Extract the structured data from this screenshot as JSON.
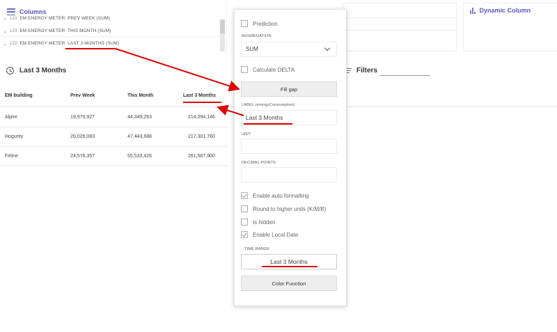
{
  "columns_panel": {
    "title": "Columns",
    "items": [
      {
        "type": "123",
        "label": "EM ENERGY METER: PREV WEEK (SUM)"
      },
      {
        "type": "123",
        "label": "EM ENERGY METER: THIS MONTH (SUM)"
      },
      {
        "type": "123",
        "label": "EM ENERGY METER: LAST 3 MONTHS (SUM)"
      }
    ]
  },
  "dynamic_column": {
    "title": "Dynamic Column"
  },
  "widget": {
    "title": "Last 3 Months"
  },
  "filters": {
    "label": "Filters"
  },
  "table": {
    "headers": [
      "EM building",
      "Prev Week",
      "This Month",
      "Last 3 Months"
    ],
    "rows": [
      [
        "Alpire",
        "19,979,927",
        "44,349,263",
        "214,094,146"
      ],
      [
        "Hogurity",
        "20,026,083",
        "47,443,688",
        "217,301,760"
      ],
      [
        "Feline",
        "24,576,357",
        "55,533,426",
        "261,587,900"
      ]
    ]
  },
  "popup": {
    "prediction_label": "Prediction",
    "aggregation_label": "AGGREGATION",
    "aggregation_value": "SUM",
    "calculate_delta_label": "Calculate DELTA",
    "fill_gap_label": "Fill gap",
    "label_field_label": "LABEL (energyConsumption)",
    "label_value": "Last 3 Months",
    "unit_label": "UNIT",
    "unit_value": "",
    "decimal_points_label": "DECIMAL POINTS",
    "decimal_points_value": "",
    "options": [
      {
        "label": "Enable auto formatting",
        "checked": true
      },
      {
        "label": "Round to higher units (K/M/B)",
        "checked": false
      },
      {
        "label": "Is hidden",
        "checked": false
      },
      {
        "label": "Enable Local Date",
        "checked": true
      }
    ],
    "time_range_label": "TIME RANGE",
    "time_range_value": "Last 3 Months",
    "color_function_label": "Color Function"
  },
  "colors": {
    "accent": "#5b57c0",
    "annotation": "#e00000"
  }
}
